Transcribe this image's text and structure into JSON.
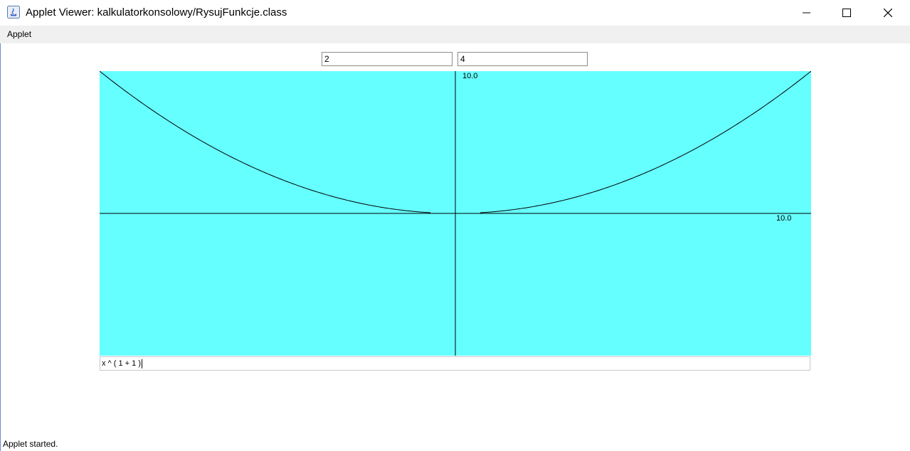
{
  "window": {
    "title": "Applet Viewer: kalkulatorkonsolowy/RysujFunkcje.class",
    "icon": "java-icon",
    "controls": [
      "minimize-icon",
      "maximize-icon",
      "close-icon"
    ]
  },
  "menu": {
    "items": [
      {
        "label": "Applet"
      }
    ]
  },
  "inputs": {
    "field1_value": "2",
    "field2_value": "4"
  },
  "plot": {
    "background": "#66ffff",
    "axis_color": "#000000",
    "y_label": "10.0",
    "x_label": "10.0",
    "formula": "x ^ ( 1 + 1 )",
    "chart_data": {
      "type": "line",
      "function": "x^2",
      "xlim": [
        -10,
        10
      ],
      "ylim": [
        -100,
        100
      ],
      "series": [
        {
          "x": [
            -10,
            -9,
            -8,
            -7,
            -6,
            -5,
            -4,
            -3,
            -2,
            -1,
            -0.7,
            0.7,
            1,
            2,
            3,
            4,
            5,
            6,
            7,
            8,
            9,
            10
          ],
          "y": [
            100,
            81,
            64,
            49,
            36,
            25,
            16,
            9,
            4,
            1,
            0.49,
            0.49,
            1,
            4,
            9,
            16,
            25,
            36,
            49,
            64,
            81,
            100
          ]
        }
      ]
    }
  },
  "status": {
    "text": "Applet started."
  }
}
